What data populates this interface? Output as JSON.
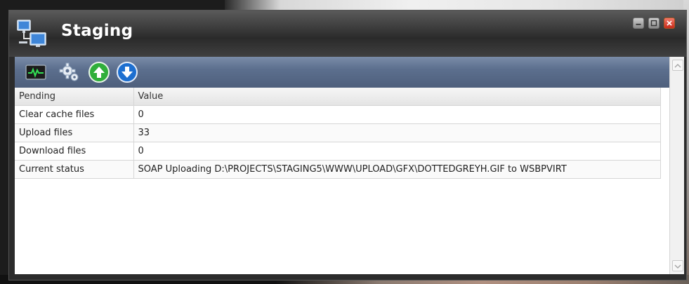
{
  "window": {
    "title": "Staging",
    "controls": [
      "minimize-icon",
      "maximize-icon",
      "close-icon"
    ]
  },
  "toolbar": {
    "buttons": [
      {
        "icon": "monitor-icon"
      },
      {
        "icon": "gear-icon"
      },
      {
        "icon": "upload-arrow-icon"
      },
      {
        "icon": "download-arrow-icon"
      }
    ]
  },
  "table": {
    "columns": [
      "Pending",
      "Value"
    ],
    "rows": [
      {
        "label": "Clear cache files",
        "value": "0"
      },
      {
        "label": "Upload files",
        "value": "33"
      },
      {
        "label": "Download files",
        "value": "0"
      },
      {
        "label": "Current status",
        "value": "SOAP Uploading D:\\PROJECTS\\STAGING5\\WWW\\UPLOAD\\GFX\\DOTTEDGREYH.GIF to WSBPVIRT"
      }
    ]
  },
  "colors": {
    "toolbar": "#5c6f8e",
    "titlebar": "#3e3e3e",
    "upload_icon": "#2fae3a",
    "download_icon": "#1d6fd0"
  }
}
